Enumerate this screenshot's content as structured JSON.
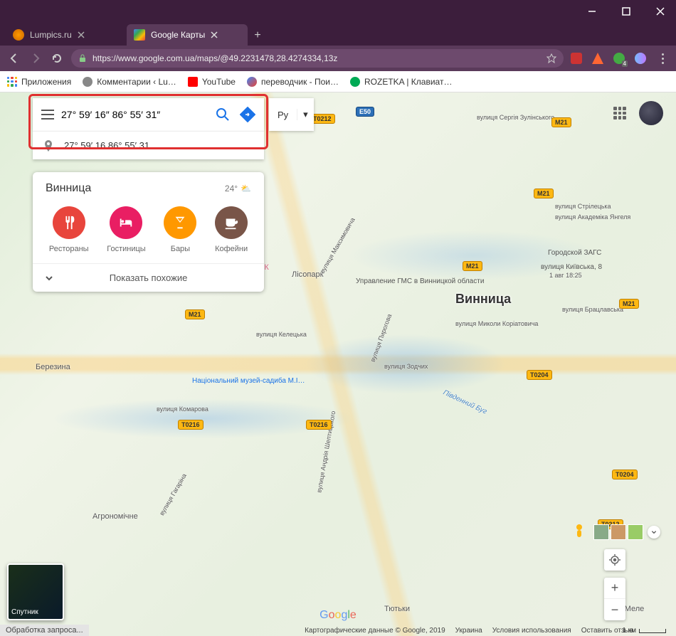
{
  "window": {
    "minimize": "–",
    "maximize": "▢",
    "close": "✕"
  },
  "tabs": {
    "t0": {
      "title": "Lumpics.ru"
    },
    "t1": {
      "title": "Google Карты"
    }
  },
  "address": {
    "url": "https://www.google.com.ua/maps/@49.2231478,28.4274334,13z"
  },
  "bookmarks": {
    "apps": "Приложения",
    "b0": "Комментарии ‹ Lu…",
    "b1": "YouTube",
    "b2": "переводчик - Пои…",
    "b3": "ROZETKA | Клавиат…"
  },
  "search": {
    "value": "27° 59′ 16″ 86° 55′ 31″",
    "suggestion": "27° 59′ 16 86° 55′ 31"
  },
  "lang": {
    "label": "Ру",
    "arrow": "▾"
  },
  "panel": {
    "city": "Винница",
    "temp": "24°",
    "categories": {
      "c0": {
        "label": "Рестораны",
        "color": "#e8453c"
      },
      "c1": {
        "label": "Гостиницы",
        "color": "#e91e63"
      },
      "c2": {
        "label": "Бары",
        "color": "#ff9800"
      },
      "c3": {
        "label": "Кофейни",
        "color": "#795548"
      }
    },
    "showMore": "Показать похожие"
  },
  "map": {
    "cityMain": "Винница",
    "places": {
      "p0": "Березина",
      "p1": "Агрономічне",
      "p2": "Тютьки",
      "p3": "Лука-Меле",
      "p4": "Лісопарк",
      "p5": "Національний музей-садиба М.І…",
      "p6": "Управление ГМС в Винницкой области",
      "p7": "Городской ЗАГС",
      "p8": "вулиця Київська, 8",
      "p9": "1 авг 18:25",
      "p10": "ентр К",
      "street0": "вулиця Келецька",
      "street1": "вулиця Пирогова",
      "street2": "вулиця Комарова",
      "street3": "вулиця Андрія Шептицького",
      "street4": "вулиця Зодчих",
      "street5": "вулиця Гагаріна",
      "street6": "вулиця Сергія Зулінського",
      "street7": "вулиця Стрілецька",
      "street8": "вулиця Академіка Янгеля",
      "street9": "вулиця Брацлавська",
      "street10": "вулиця Максимовича",
      "street11": "Південний Буг",
      "street12": "вулиця Миколи Коріатовича"
    },
    "roads": {
      "m21": "M21",
      "e50": "E50",
      "t0204": "T0204",
      "t0212": "T0212",
      "t0216": "T0216"
    }
  },
  "satellite": {
    "label": "Спутник"
  },
  "status": "Обработка запроса...",
  "attribution": {
    "a0": "Картографические данные © Google, 2019",
    "a1": "Украина",
    "a2": "Условия использования",
    "a3": "Оставить отзыв"
  },
  "scale": "1 км",
  "glogo": "Google"
}
